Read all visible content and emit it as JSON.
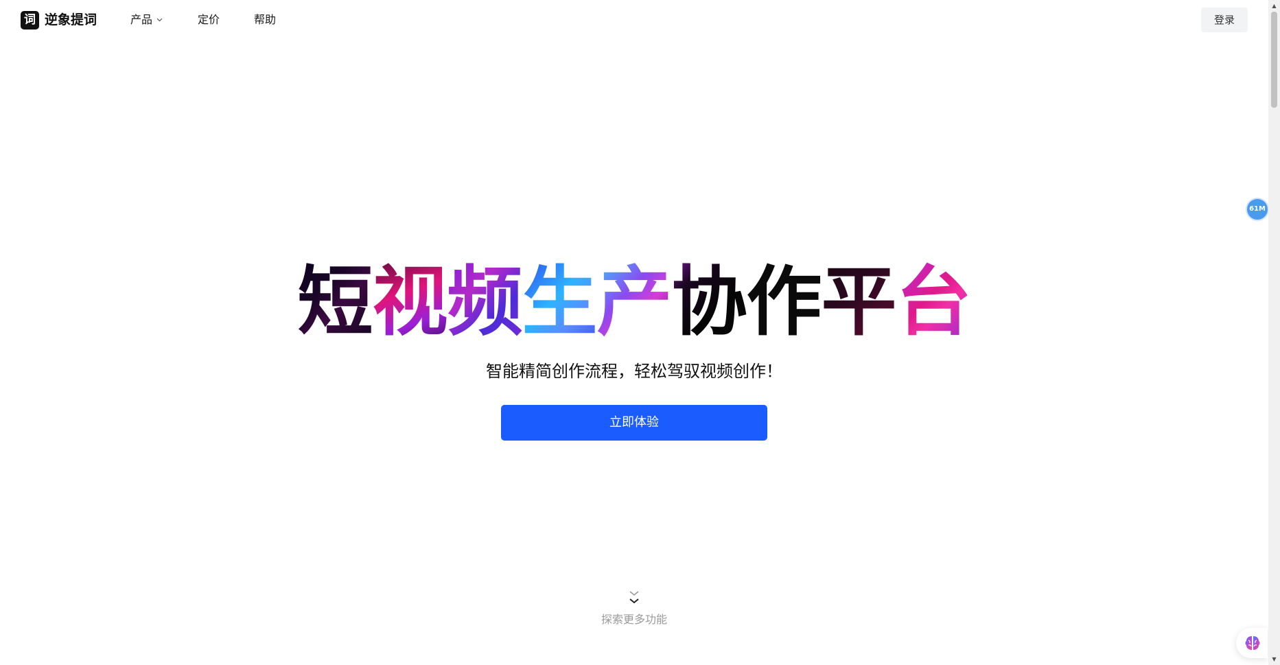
{
  "header": {
    "logo_mark": "词",
    "logo_text": "逆象提词",
    "nav": {
      "product": "产品",
      "pricing": "定价",
      "help": "帮助"
    },
    "login_label": "登录"
  },
  "hero": {
    "title_chars": [
      "短",
      "视",
      "频",
      "生",
      "产",
      "协",
      "作",
      "平",
      "台"
    ],
    "subtitle": "智能精简创作流程，轻松驾驭视频创作！",
    "cta_label": "立即体验"
  },
  "explore": {
    "label": "探索更多功能"
  },
  "floating": {
    "badge_label": "61M",
    "ai_icon": "brain-icon"
  },
  "colors": {
    "primary": "#1a5cff",
    "badge": "#4a9bf0",
    "login_bg": "#f2f3f5",
    "muted_text": "#9a9a9a"
  }
}
